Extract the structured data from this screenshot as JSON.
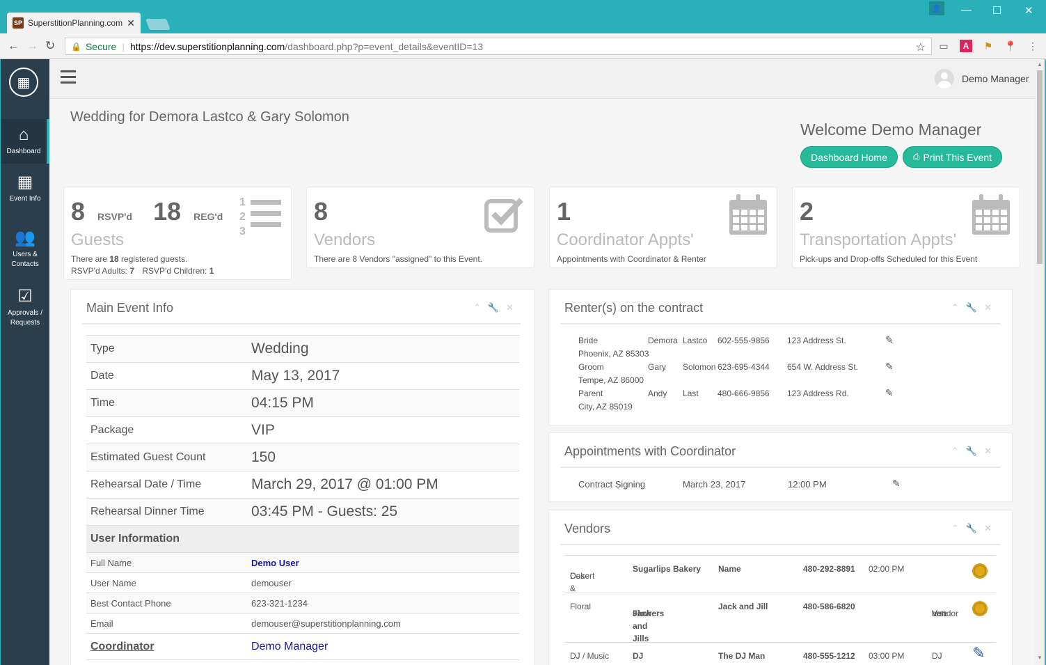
{
  "browser": {
    "tab_title": "SuperstitionPlanning.com",
    "favicon_text": "SP",
    "url_secure": "Secure",
    "url_host": "https://dev.superstitionplanning.com",
    "url_path": "/dashboard.php?p=event_details&eventID=13"
  },
  "sidebar": {
    "items": [
      {
        "label": "Dashboard",
        "icon": "home-icon"
      },
      {
        "label": "Event Info",
        "icon": "calendar-icon"
      },
      {
        "label": "Users & Contacts",
        "icon": "users-icon"
      },
      {
        "label": "Approvals / Requests",
        "icon": "calendar-check-icon"
      }
    ]
  },
  "header": {
    "user_name": "Demo Manager"
  },
  "page": {
    "event_title": "Wedding for Demora Lastco & Gary Solomon",
    "welcome": "Welcome Demo Manager",
    "btn_home": "Dashboard Home",
    "btn_print": "Print This Event"
  },
  "tiles": {
    "guests": {
      "rsvp_count": "8",
      "rsvp_label": "RSVP'd",
      "reg_count": "18",
      "reg_label": "REG'd",
      "label": "Guests",
      "desc_pre": "There are ",
      "desc_num": "18",
      "desc_post": " registered guests.",
      "adults_label": "RSVP'd Adults: ",
      "adults": "7",
      "children_label": "RSVP'd Children: ",
      "children": "1"
    },
    "vendors": {
      "count": "8",
      "label": "Vendors",
      "desc": "There are 8 Vendors \"assigned\" to this Event."
    },
    "coordinator": {
      "count": "1",
      "label": "Coordinator Appts'",
      "desc": "Appointments with Coordinator & Renter"
    },
    "transport": {
      "count": "2",
      "label": "Transportation Appts'",
      "desc": "Pick-ups and Drop-offs Scheduled for this Event"
    }
  },
  "main_event": {
    "title": "Main Event Info",
    "rows": [
      {
        "k": "Type",
        "v": "Wedding"
      },
      {
        "k": "Date",
        "v": "May 13, 2017"
      },
      {
        "k": "Time",
        "v": "04:15 PM"
      },
      {
        "k": "Package",
        "v": "VIP"
      },
      {
        "k": "Estimated Guest Count",
        "v": "150"
      },
      {
        "k": "Rehearsal Date / Time",
        "v": "March 29, 2017 @ 01:00 PM"
      },
      {
        "k": "Rehearsal Dinner Time",
        "v": "03:45 PM - Guests: 25"
      }
    ],
    "user_info_label": "User Information",
    "user_rows": [
      {
        "k": "Full Name",
        "v": "Demo User"
      },
      {
        "k": "User Name",
        "v": "demouser"
      },
      {
        "k": "Best Contact Phone",
        "v": "623-321-1234"
      },
      {
        "k": "Email",
        "v": "demouser@superstitionplanning.com"
      }
    ],
    "coordinator_label": "Coordinator",
    "coordinator_value": "Demo Manager"
  },
  "renters": {
    "title": "Renter(s) on the contract",
    "rows": [
      {
        "role": "Bride",
        "first": "Demora",
        "last": "Lastco",
        "phone": "602-555-9856",
        "addr": "123 Address St.",
        "city": "Phoenix, AZ 85303"
      },
      {
        "role": "Groom",
        "first": "Gary",
        "last": "Solomon",
        "phone": "623-695-4344",
        "addr": "654 W. Address St.",
        "city": "Tempe, AZ 86000"
      },
      {
        "role": "Parent",
        "first": "Andy",
        "last": "Last",
        "phone": "480-666-9856",
        "addr": "123 Address Rd.",
        "city": "City, AZ 85019"
      }
    ]
  },
  "appointments": {
    "title": "Appointments with Coordinator",
    "rows": [
      {
        "name": "Contract Signing",
        "date": "March 23, 2017",
        "time": "12:00 PM"
      }
    ]
  },
  "vendors": {
    "title": "Vendors",
    "rows": [
      {
        "cat1": "Cake &",
        "cat2": "Desert",
        "biz1": "Sugarlips Bakery",
        "biz2": "",
        "contact": "Name",
        "phone": "480-292-8891",
        "time": "02:00 PM",
        "note1": "",
        "note2": "",
        "note3": ""
      },
      {
        "cat1": "Floral",
        "cat2": "",
        "biz1": "Jack and Jills",
        "biz2": "Flowers",
        "contact": "Jack and Jill",
        "phone": "480-586-6820",
        "time": "",
        "note1": "Vendor",
        "note2": "note",
        "note3": "test."
      },
      {
        "cat1": "DJ / Music",
        "cat2": "",
        "biz1": "DJ",
        "biz2": "",
        "contact": "The DJ Man",
        "phone": "480-555-1212",
        "time": "03:00 PM",
        "note1": "DJ",
        "note2": "",
        "note3": ""
      }
    ]
  }
}
